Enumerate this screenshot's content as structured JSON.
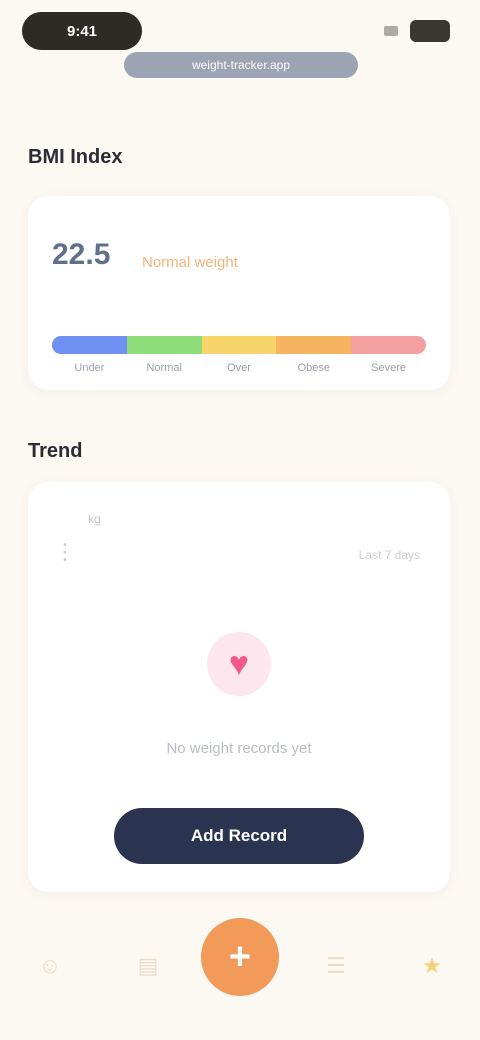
{
  "status": {
    "time": "9:41"
  },
  "browser": {
    "url": "weight-tracker.app"
  },
  "bmi": {
    "section_title": "BMI Index",
    "value": "22.5",
    "label": "Normal weight",
    "scale": [
      {
        "label": "Under",
        "color": "#6f8ff2"
      },
      {
        "label": "Normal",
        "color": "#8fdc7a"
      },
      {
        "label": "Over",
        "color": "#f7d56b"
      },
      {
        "label": "Obese",
        "color": "#f6b461"
      },
      {
        "label": "Severe",
        "color": "#f4a0a0"
      }
    ]
  },
  "weight": {
    "section_title": "Trend",
    "unit_label": "kg",
    "axis_icon": "chart-icon",
    "range_text": "Last 7 days",
    "empty_text": "No weight records yet",
    "cta_label": "Add Record"
  },
  "tabs": [
    {
      "name": "home",
      "icon": "☺"
    },
    {
      "name": "stats",
      "icon": "▤"
    },
    {
      "name": "add",
      "icon": "+"
    },
    {
      "name": "history",
      "icon": "☰"
    },
    {
      "name": "profile",
      "icon": "★"
    }
  ]
}
